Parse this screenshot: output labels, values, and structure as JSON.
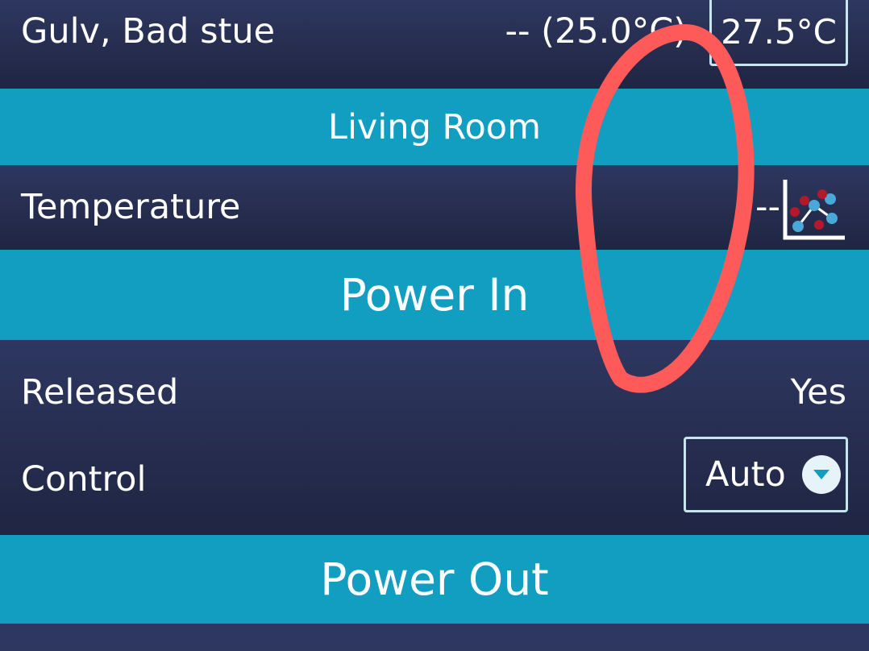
{
  "rows": {
    "gulv": {
      "label": "Gulv, Bad stue",
      "reading": "-- (25.0°C)",
      "setpoint": "27.5°C"
    },
    "living_room_header": "Living Room",
    "temperature": {
      "label": "Temperature",
      "value": "--",
      "icon": "chart-icon"
    },
    "power_in_header": "Power In",
    "released": {
      "label": "Released",
      "value": "Yes"
    },
    "control": {
      "label": "Control",
      "selected": "Auto",
      "icon": "chevron-down-icon"
    },
    "power_out_header": "Power Out"
  },
  "colors": {
    "header": "#129ec0",
    "row_dark": "#232a48",
    "annotation": "#ff5a5a"
  }
}
